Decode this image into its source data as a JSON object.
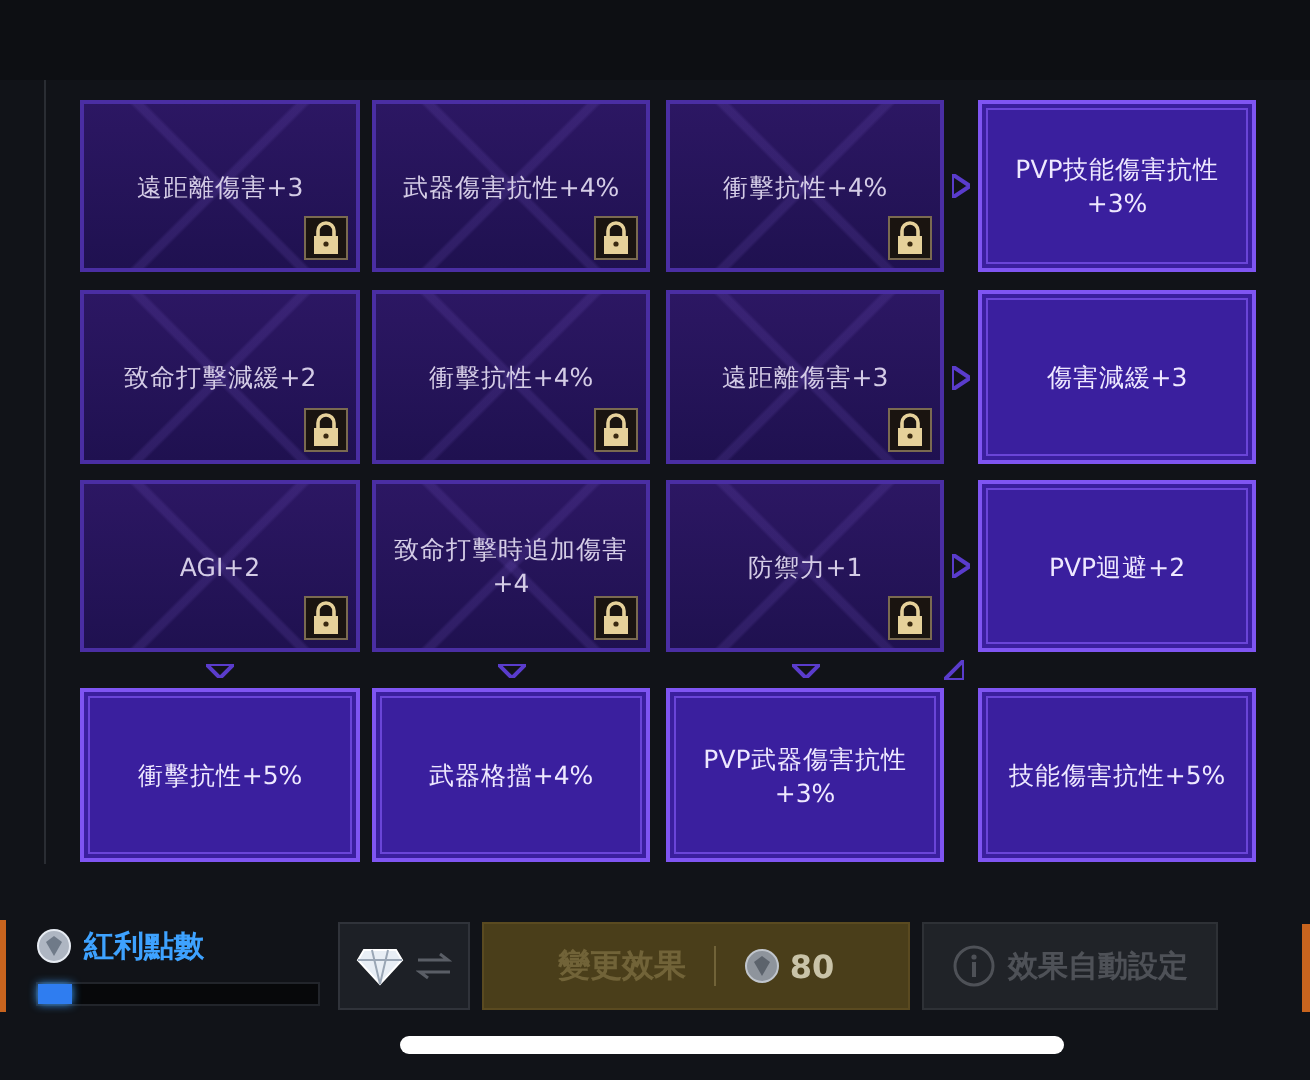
{
  "grid": {
    "rows": [
      {
        "cells": [
          {
            "label": "遠距離傷害+3",
            "locked": true
          },
          {
            "label": "武器傷害抗性+4%",
            "locked": true
          },
          {
            "label": "衝擊抗性+4%",
            "locked": true
          },
          {
            "label": "PVP技能傷害抗性+3%",
            "locked": false
          }
        ]
      },
      {
        "cells": [
          {
            "label": "致命打擊減緩+2",
            "locked": true
          },
          {
            "label": "衝擊抗性+4%",
            "locked": true
          },
          {
            "label": "遠距離傷害+3",
            "locked": true
          },
          {
            "label": "傷害減緩+3",
            "locked": false
          }
        ]
      },
      {
        "cells": [
          {
            "label": "AGI+2",
            "locked": true
          },
          {
            "label": "致命打擊時追加傷害+4",
            "locked": true
          },
          {
            "label": "防禦力+1",
            "locked": true
          },
          {
            "label": "PVP迴避+2",
            "locked": false
          }
        ]
      },
      {
        "cells": [
          {
            "label": "衝擊抗性+5%",
            "locked": false
          },
          {
            "label": "武器格擋+4%",
            "locked": false
          },
          {
            "label": "PVP武器傷害抗性+3%",
            "locked": false
          },
          {
            "label": "技能傷害抗性+5%",
            "locked": false
          }
        ]
      }
    ]
  },
  "bonus_points": {
    "label": "紅利點數",
    "level": 0.12
  },
  "actions": {
    "change": {
      "label": "變更效果",
      "cost": "80",
      "disabled": true
    },
    "auto": {
      "label": "效果自動設定",
      "disabled": true
    }
  }
}
